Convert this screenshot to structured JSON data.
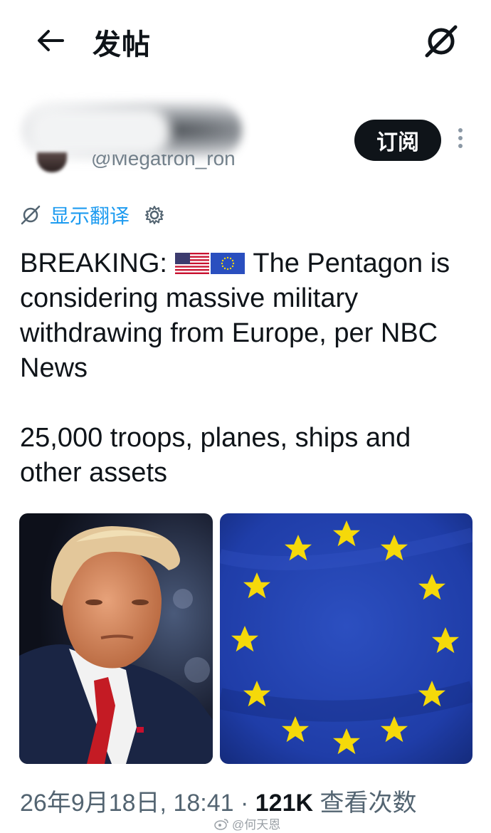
{
  "header": {
    "title": "发帖",
    "back_icon": "arrow-left-icon",
    "grok_icon": "grok-icon"
  },
  "author": {
    "handle": "@Megatron_ron",
    "subscribe_label": "订阅"
  },
  "translate": {
    "label": "显示翻译"
  },
  "post": {
    "prefix": "BREAKING:",
    "line1_rest": "The Pentagon is",
    "line2": "considering massive military",
    "line3": "withdrawing from Europe, per NBC",
    "line4": "News",
    "para2_line1": "25,000 troops, planes, ships and",
    "para2_line2": "other assets"
  },
  "meta": {
    "timestamp": "26年9月18日, 18:41",
    "separator": "·",
    "views_count": "121K",
    "views_label": "查看次数"
  },
  "watermark": {
    "text": "@何天恩"
  },
  "colors": {
    "accent": "#1d9bf0",
    "text": "#0f1419",
    "muted": "#536471",
    "eu_blue": "#1f3da8",
    "eu_star": "#f5d90a"
  }
}
